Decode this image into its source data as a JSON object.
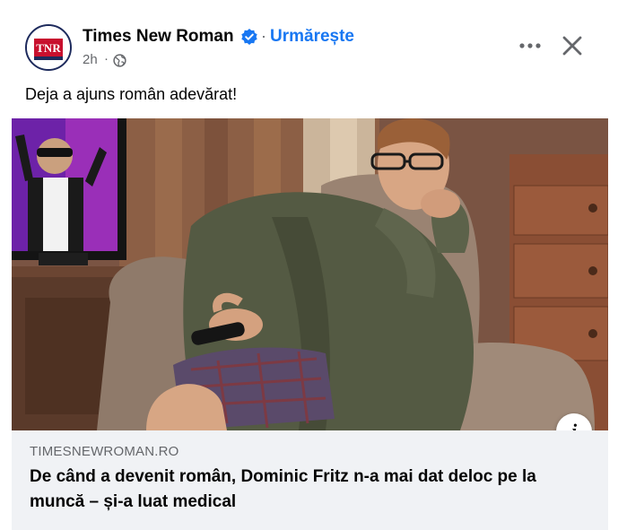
{
  "post": {
    "page_name": "Times New Roman",
    "follow_label": "Urmărește",
    "separator": "·",
    "time": "2h",
    "time_separator": "·",
    "caption": "Deja a ajuns român adevărat!",
    "avatar_text": "TNR"
  },
  "link": {
    "domain": "TIMESNEWROMAN.RO",
    "headline": "De când a devenit român, Dominic Fritz n-a mai dat deloc pe la muncă – și-a luat medical"
  },
  "icons": {
    "verified": "verified-badge-icon",
    "globe": "globe-icon",
    "more": "more-options-icon",
    "close": "close-icon",
    "info": "info-icon"
  },
  "colors": {
    "accent": "#1877f2",
    "secondary_text": "#65676b",
    "preview_bg": "#f0f2f5"
  },
  "info_label": "i"
}
